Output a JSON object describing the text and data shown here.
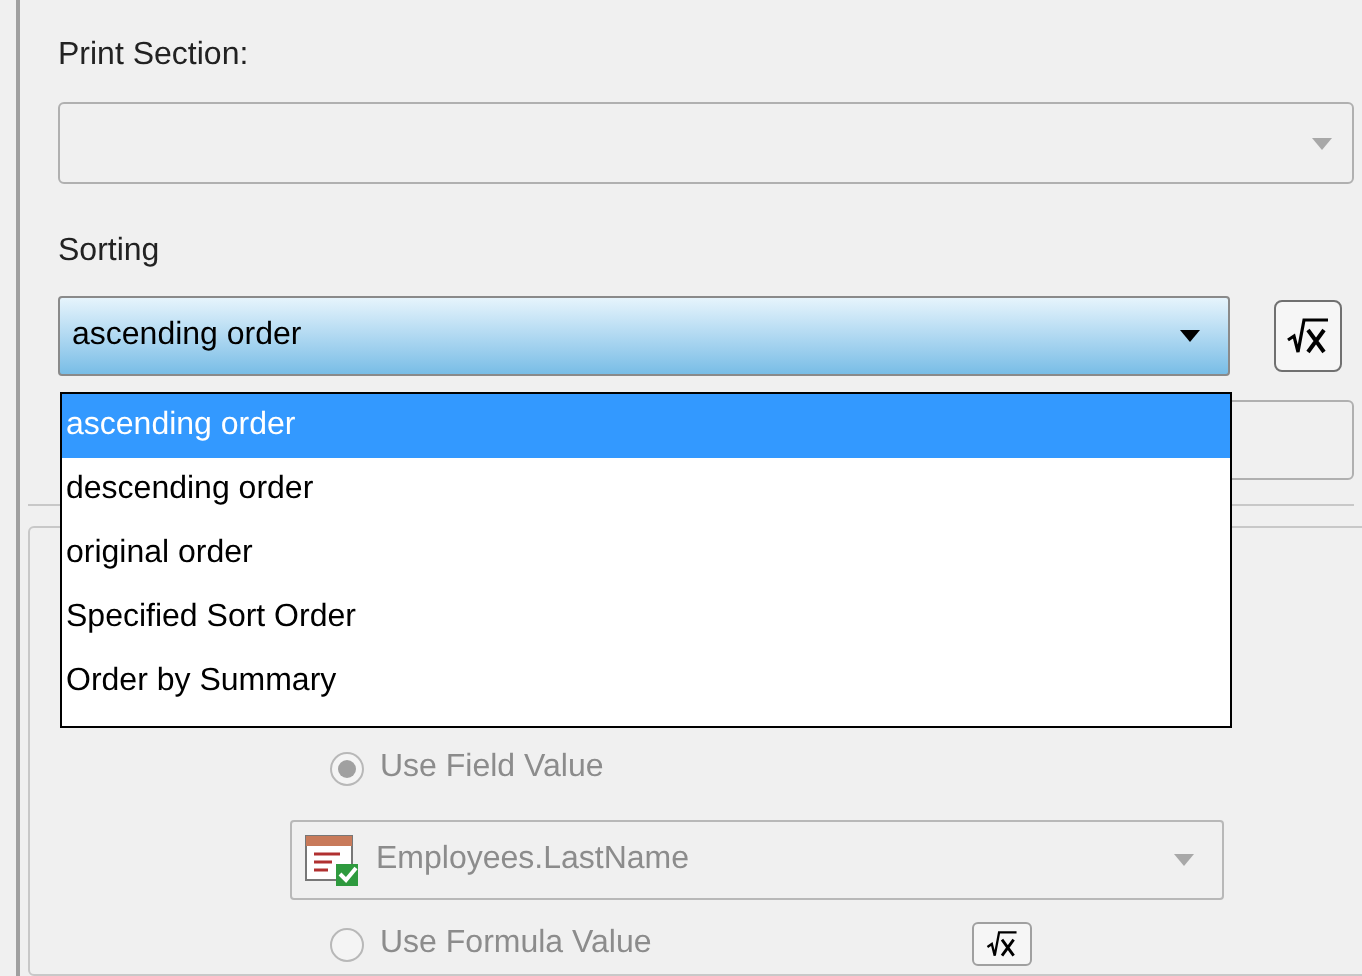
{
  "print_section": {
    "label": "Print Section:"
  },
  "sorting": {
    "label": "Sorting",
    "value": "ascending order",
    "expanded": true,
    "options": [
      {
        "label": "ascending order",
        "selected": true
      },
      {
        "label": "descending order",
        "selected": false
      },
      {
        "label": "original order",
        "selected": false
      },
      {
        "label": "Specified Sort Order",
        "selected": false
      },
      {
        "label": "Order by Summary",
        "selected": false
      }
    ]
  },
  "field_value": {
    "label": "Use Field Value",
    "selected": true,
    "disabled": true,
    "field": "Employees.LastName"
  },
  "formula_value": {
    "label": "Use Formula Value",
    "selected": false,
    "disabled": true
  }
}
